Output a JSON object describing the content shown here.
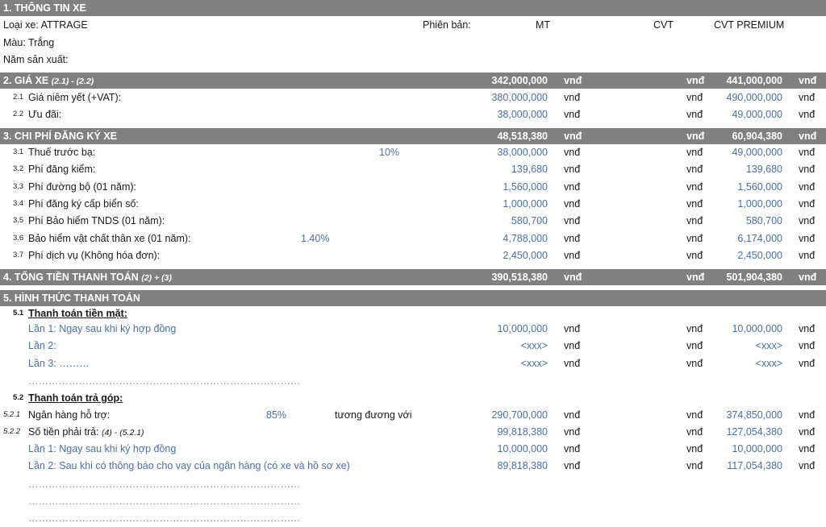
{
  "s1": {
    "title": "1. THÔNG TIN XE",
    "loai_xe": "Loại xe: ATTRAGE",
    "phien_ban": "Phiên bản:",
    "mt": "MT",
    "cvt": "CVT",
    "cvt_premium": "CVT PREMIUM",
    "mau": "Màu: Trắng",
    "nam_sx": "Năm sản xuất:"
  },
  "s2": {
    "title": "2. GIÁ XE",
    "formula": "(2.1) - (2.2)",
    "total_mt": "342,000,000",
    "total_pre": "441,000,000",
    "unit": "vnđ",
    "items": [
      {
        "num": "2.1",
        "label": "Giá niêm yết (+VAT):",
        "mt": "380,000,000",
        "pre": "490,000,000"
      },
      {
        "num": "2.2",
        "label": "Ưu đãi:",
        "mt": "38,000,000",
        "pre": "49,000,000"
      }
    ]
  },
  "s3": {
    "title": "3. CHI PHÍ ĐĂNG KÝ XE",
    "total_mt": "48,518,380",
    "total_pre": "60,904,380",
    "items": [
      {
        "num": "3.1",
        "label": "Thuế trước bạ:",
        "rate": "10%",
        "mt": "38,000,000",
        "pre": "49,000,000"
      },
      {
        "num": "3.2",
        "label": "Phí đăng kiểm:",
        "mt": "139,680",
        "pre": "139,680"
      },
      {
        "num": "3.3",
        "label": "Phí đường bộ (01 năm):",
        "mt": "1,560,000",
        "pre": "1,560,000"
      },
      {
        "num": "3.4",
        "label": "Phí đăng ký cấp biển số:",
        "mt": "1,000,000",
        "pre": "1,000,000"
      },
      {
        "num": "3.5",
        "label": "Phí Bảo hiểm TNDS (01 năm):",
        "mt": "580,700",
        "pre": "580,700"
      },
      {
        "num": "3.6",
        "label": "Bảo hiểm vật chất thân xe (01 năm):",
        "rate": "1.40%",
        "mt": "4,788,000",
        "pre": "6,174,000"
      },
      {
        "num": "3.7",
        "label": "Phí dịch vụ (Không hóa đơn):",
        "mt": "2,450,000",
        "pre": "2,450,000"
      }
    ]
  },
  "s4": {
    "title": "4. TỔNG TIỀN THANH TOÁN",
    "formula": "(2) + (3)",
    "total_mt": "390,518,380",
    "total_pre": "501,904,380"
  },
  "s5": {
    "title": "5. HÌNH THỨC THANH TOÁN",
    "sub1_num": "5.1",
    "sub1_label": "Thanh toán tiền mặt:",
    "cash": [
      {
        "label": "Lần 1: Ngay sau khi ký hợp đồng",
        "mt": "10,000,000",
        "pre": "10,000,000"
      },
      {
        "label": "Lần 2:",
        "mt": "<xxx>",
        "pre": "<xxx>"
      },
      {
        "label": "Lần 3: ………",
        "mt": "<xxx>",
        "pre": "<xxx>"
      }
    ],
    "dots": "………………………………………………………………………",
    "sub2_num": "5.2",
    "sub2_label": "Thanh toán trả góp:",
    "bank_num": "5.2.1",
    "bank_label": "Ngân hàng hỗ trợ:",
    "bank_rate": "85%",
    "equiv": "tương đương với",
    "bank_mt": "290,700,000",
    "bank_pre": "374,850,000",
    "pay_num": "5.2.2",
    "pay_label": "Số tiền phải trả:",
    "pay_formula": "(4) - (5.2.1)",
    "pay_mt": "99,818,380",
    "pay_pre": "127,054,380",
    "inst": [
      {
        "label": "Lần 1: Ngay sau khi ký hợp đồng",
        "mt": "10,000,000",
        "pre": "10,000,000"
      },
      {
        "label": "Lần 2: Sau khi có thông báo cho vay của ngân hàng (có xe và hồ sơ xe)",
        "mt": "89,818,380",
        "pre": "117,054,380"
      }
    ]
  }
}
